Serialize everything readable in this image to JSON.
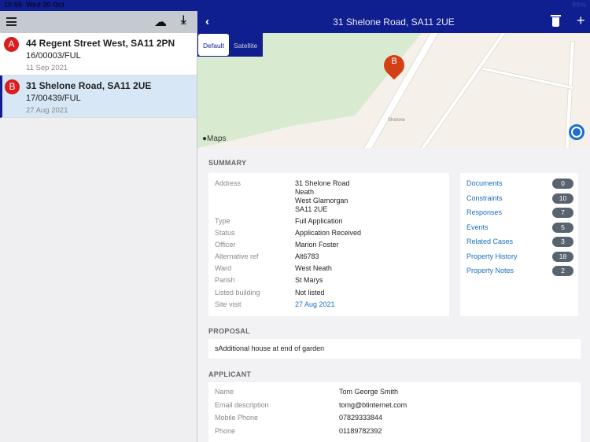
{
  "status": {
    "time": "10:55",
    "date": "Wed 20 Oct",
    "battery": "99%"
  },
  "list": [
    {
      "letter": "A",
      "address": "44 Regent Street West, SA11 2PN",
      "ref": "16/00003/FUL",
      "date": "11 Sep 2021"
    },
    {
      "letter": "B",
      "address": "31 Shelone Road, SA11 2UE",
      "ref": "17/00439/FUL",
      "date": "27 Aug 2021"
    }
  ],
  "nav": {
    "title": "31 Shelone Road, SA11 2UE"
  },
  "map": {
    "tabs": [
      "Default",
      "Satellite"
    ],
    "pin": "B",
    "place": "Shelone",
    "attribution": "Maps"
  },
  "summary": {
    "heading": "SUMMARY",
    "fields": [
      {
        "label": "Address",
        "value": "31 Shelone Road\nNeath\nWest Glamorgan\nSA11 2UE"
      },
      {
        "label": "Type",
        "value": "Full Application"
      },
      {
        "label": "Status",
        "value": "Application Received"
      },
      {
        "label": "Officer",
        "value": "Marion Foster"
      },
      {
        "label": "Alternative ref",
        "value": "Alt6783"
      },
      {
        "label": "Ward",
        "value": "West Neath"
      },
      {
        "label": "Parish",
        "value": "St Marys"
      },
      {
        "label": "Listed building",
        "value": "Not listed"
      },
      {
        "label": "Site visit",
        "value": "27 Aug 2021"
      }
    ],
    "links": [
      {
        "label": "Documents",
        "count": "0"
      },
      {
        "label": "Constraints",
        "count": "10"
      },
      {
        "label": "Responses",
        "count": "7"
      },
      {
        "label": "Events",
        "count": "5"
      },
      {
        "label": "Related Cases",
        "count": "3"
      },
      {
        "label": "Property History",
        "count": "18"
      },
      {
        "label": "Property Notes",
        "count": "2"
      }
    ]
  },
  "proposal": {
    "heading": "PROPOSAL",
    "text": "sAdditional house at end of garden"
  },
  "applicant": {
    "heading": "APPLICANT",
    "fields": [
      {
        "label": "Name",
        "value": "Tom George Smith"
      },
      {
        "label": "Email description",
        "value": "tomg@btinternet.com"
      },
      {
        "label": "Mobile Phone",
        "value": "07829333844"
      },
      {
        "label": "Phone",
        "value": "01189782392"
      }
    ]
  }
}
